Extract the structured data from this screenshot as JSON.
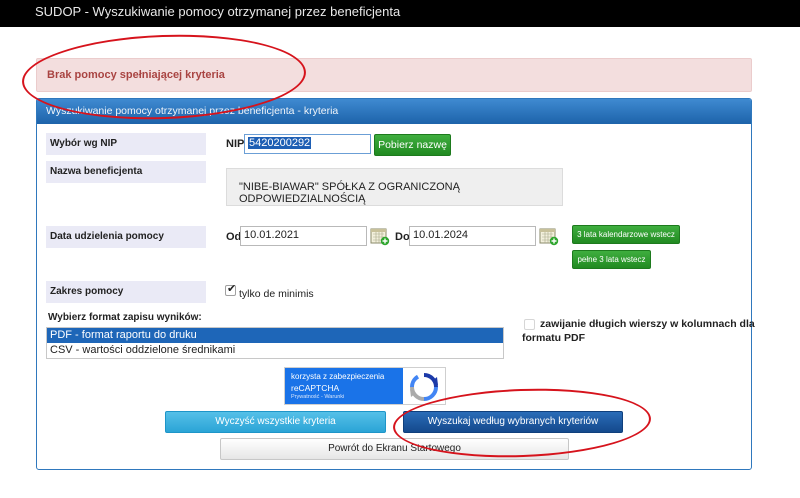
{
  "window": {
    "title": "SUDOP - Wyszukiwanie pomocy otrzymanej przez beneficjenta"
  },
  "alert": {
    "message": "Brak pomocy spełniającej kryteria"
  },
  "panel": {
    "header": "Wyszukiwanie pomocy otrzymanej przez beneficjenta - kryteria"
  },
  "nip_section": {
    "label": "Wybór wg NIP",
    "field_label": "NIP",
    "value": "5420200292",
    "fetch_button": "Pobierz nazwę"
  },
  "beneficiary": {
    "label": "Nazwa beneficjenta",
    "value": "\"NIBE-BIAWAR\" SPÓŁKA Z OGRANICZONĄ ODPOWIEDZIALNOŚCIĄ"
  },
  "date_section": {
    "label": "Data udzielenia pomocy",
    "from_label": "Od",
    "from_value": "10.01.2021",
    "to_label": "Do",
    "to_value": "10.01.2024",
    "btn_calendar_years": "3 lata kalendarzowe wstecz",
    "btn_full_years": "pełne 3 lata wstecz"
  },
  "scope_section": {
    "label": "Zakres pomocy",
    "checkbox_label": "tylko de minimis",
    "checked": true
  },
  "format_section": {
    "label": "Wybierz format zapisu wyników:",
    "options": [
      {
        "label": "PDF - format raportu do druku",
        "selected": true
      },
      {
        "label": "CSV - wartości oddzielone średnikami",
        "selected": false
      }
    ],
    "wrap_checkbox_line1": "zawijanie długich wierszy w kolumnach dla",
    "wrap_checkbox_line2": "formatu PDF",
    "wrap_checked": false
  },
  "captcha": {
    "line1": "korzysta z zabezpieczenia",
    "line2": "reCAPTCHA",
    "line3": "Prywatność - Warunki"
  },
  "actions": {
    "clear": "Wyczyść wszystkie kryteria",
    "search": "Wyszukaj według wybranych kryteriów",
    "back": "Powrót do Ekranu Startowego"
  },
  "colors": {
    "topbar": "#000000",
    "panel_header": "#1d63aa",
    "alert_bg": "#f3dede",
    "alert_text": "#a94442",
    "green_button": "#218a21",
    "annotation": "#d6131c"
  }
}
